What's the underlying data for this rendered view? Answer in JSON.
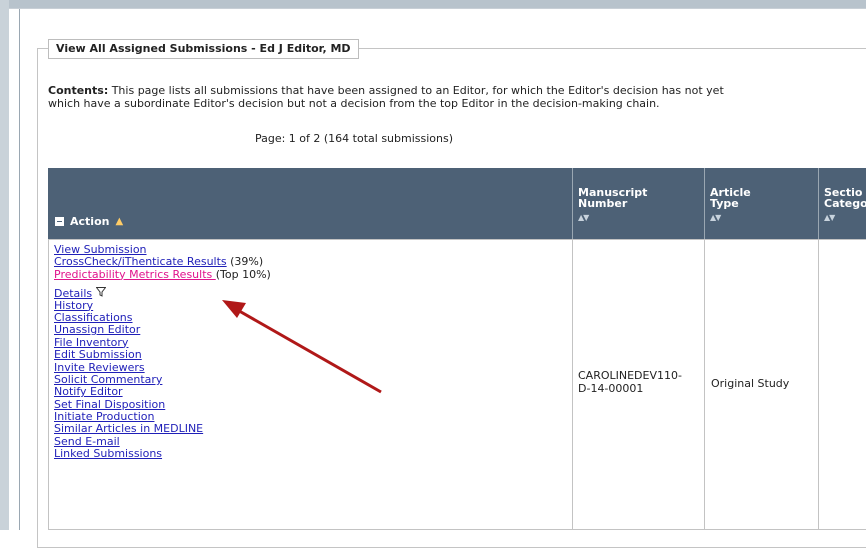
{
  "panel": {
    "title": "View All Assigned Submissions - Ed J Editor, MD"
  },
  "contents": {
    "label": "Contents:",
    "line1": " This page lists all submissions that have been assigned to an Editor, for which the Editor's decision has not yet",
    "line2": "which have a subordinate Editor's decision but not a decision from the top Editor in the decision-making chain."
  },
  "pagination": {
    "text": "Page: 1 of 2 (164 total submissions)"
  },
  "table": {
    "headers": {
      "action": "Action",
      "manuscript_number": [
        "Manuscript",
        "Number"
      ],
      "article_type": [
        "Article",
        "Type"
      ],
      "section": [
        "Sectio",
        "Catego"
      ]
    },
    "row": {
      "links": {
        "view_submission": "View Submission",
        "crosscheck": "CrossCheck/iThenticate Results",
        "crosscheck_note": " (39%)",
        "predictability": "Predictability Metrics Results ",
        "predictability_note": "(Top 10%)",
        "details": "Details",
        "history": "History",
        "classifications": "Classifications",
        "unassign_editor": "Unassign Editor",
        "file_inventory": "File Inventory",
        "edit_submission": "Edit Submission",
        "invite_reviewers": "Invite Reviewers",
        "solicit_commentary": "Solicit Commentary",
        "notify_editor": "Notify Editor",
        "set_final_disposition": "Set Final Disposition",
        "initiate_production": "Initiate Production",
        "similar_articles": "Similar Articles in MEDLINE",
        "send_email": "Send E-mail",
        "linked_submissions": "Linked Submissions"
      },
      "manuscript_number": [
        "CAROLINEDEV110-",
        "D-14-00001"
      ],
      "article_type": "Original Study"
    }
  },
  "colors": {
    "header_bg": "#4d6176",
    "link": "#1f1fb8",
    "highlight_link": "#e0138c",
    "annotation_arrow": "#b01818"
  },
  "icons": [
    "minus-box-icon",
    "warning-triangle-icon",
    "sort-arrows-icon",
    "filter-funnel-icon",
    "annotation-arrow"
  ]
}
